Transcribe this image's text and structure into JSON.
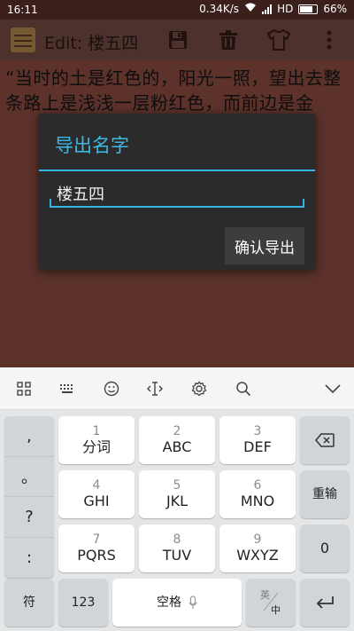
{
  "status_bar": {
    "time": "16:11",
    "speed": "0.34K/s",
    "network": "HD",
    "battery": "66%"
  },
  "action_bar": {
    "title": "Edit: 楼五四"
  },
  "note": {
    "text": "“当时的土是红色的，阳光一照，望出去整条路上是浅浅一层粉红色，而前边是金"
  },
  "dialog": {
    "title": "导出名字",
    "input_value": "楼五四",
    "confirm_label": "确认导出"
  },
  "keyboard": {
    "punctuation": [
      ",",
      "。",
      "?",
      ":"
    ],
    "keys": [
      {
        "num": "1",
        "label": "分词"
      },
      {
        "num": "2",
        "label": "ABC"
      },
      {
        "num": "3",
        "label": "DEF"
      },
      {
        "num": "4",
        "label": "GHI"
      },
      {
        "num": "5",
        "label": "JKL"
      },
      {
        "num": "6",
        "label": "MNO"
      },
      {
        "num": "7",
        "label": "PQRS"
      },
      {
        "num": "8",
        "label": "TUV"
      },
      {
        "num": "9",
        "label": "WXYZ"
      }
    ],
    "reenter_label": "重输",
    "zero_label": "0",
    "symbol_label": "符",
    "num_label": "123",
    "space_label": "空格",
    "lang_top": "英",
    "lang_bottom": "中"
  },
  "colors": {
    "accent": "#33b5e5",
    "note_bg": "#6d3b33",
    "dialog_bg": "#2b2b2b"
  }
}
